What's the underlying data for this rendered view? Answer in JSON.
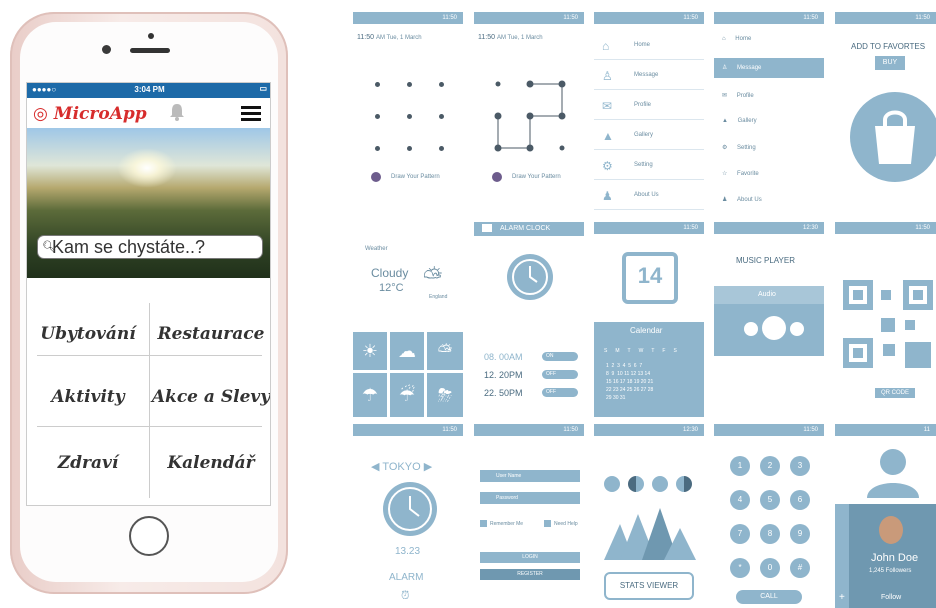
{
  "phone": {
    "status_time": "3:04 PM",
    "app_name": "MicroApp",
    "search_placeholder": "Kam se chystáte..?",
    "tiles": [
      "Ubytování",
      "Restaurace",
      "Aktivity",
      "Akce a Slevy",
      "Zdraví",
      "Kalendář"
    ]
  },
  "pattern1": {
    "time": "11:50",
    "date": "AM Tue, 1 March",
    "hint": "Draw Your Pattern"
  },
  "pattern2": {
    "time": "11:50",
    "date": "AM Tue, 1 March",
    "hint": "Draw Your Pattern"
  },
  "menu1": {
    "items": [
      "Home",
      "Message",
      "Profile",
      "Gallery",
      "Setting",
      "About Us"
    ]
  },
  "menu2": {
    "items": [
      "Home",
      "Message",
      "Profile",
      "Gallery",
      "Setting",
      "Favorite",
      "About Us"
    ]
  },
  "favorites": {
    "title": "ADD TO FAVORTES",
    "button": "BUY"
  },
  "weather": {
    "label": "Weather",
    "condition": "Cloudy",
    "temp": "12°C",
    "sub": "England"
  },
  "alarm_clock": {
    "title": "ALARM CLOCK",
    "alarms": [
      {
        "time": "08. 00AM",
        "state": "ON"
      },
      {
        "time": "12. 20PM",
        "state": "OFF"
      },
      {
        "time": "22. 50PM",
        "state": "OFF"
      }
    ]
  },
  "calendar": {
    "day": "14",
    "title": "Calendar",
    "weekdays": [
      "S",
      "M",
      "T",
      "W",
      "T",
      "F",
      "S"
    ],
    "rows": [
      "1  2  3  4  5  6  7",
      "8  9  10 11 12 13 14",
      "15 16 17 18 19 20 21",
      "22 23 24 25 26 27 28",
      "29 30 31"
    ]
  },
  "music": {
    "title": "MUSIC PLAYER",
    "label": "Audio"
  },
  "qr": {
    "label": "QR CODE"
  },
  "tokyo": {
    "city": "TOKYO",
    "time": "13.23",
    "label": "ALARM"
  },
  "login": {
    "username": "User Name",
    "password": "Password",
    "remember": "Remember Me",
    "need_help": "Need Help",
    "login": "LOGIN",
    "register": "REGISTER"
  },
  "stats": {
    "label": "STATS VIEWER"
  },
  "keypad": {
    "keys": [
      "1",
      "2",
      "3",
      "4",
      "5",
      "6",
      "7",
      "8",
      "9",
      "*",
      "0",
      "#"
    ],
    "call": "CALL"
  },
  "profile": {
    "name": "John Doe",
    "followers": "1,245 Followers",
    "follow": "Follow"
  },
  "status_times": [
    "11:50",
    "11:50",
    "11:50",
    "11:50",
    "11:50",
    "11:50",
    "12:30",
    "11:50",
    "11:50",
    "11:50",
    "12:30",
    "11:50",
    "11"
  ]
}
